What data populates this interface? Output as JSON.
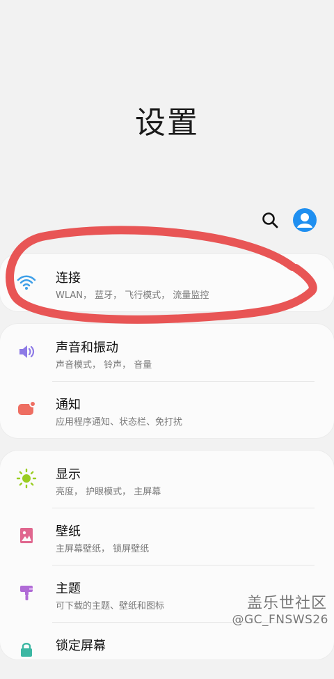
{
  "page": {
    "title": "设置"
  },
  "header": {
    "search_icon": "search-icon",
    "profile_icon": "profile-avatar-icon"
  },
  "colors": {
    "annotation_red": "#e74c4c",
    "wifi_blue": "#3e9fe8",
    "sound_purple": "#8d7ae6",
    "notify_coral": "#ee6e62",
    "display_green": "#9acd22",
    "wallpaper_pink": "#e0668e",
    "theme_violet": "#b06bd6",
    "avatar_blue": "#1f8ff0"
  },
  "sections": [
    {
      "items": [
        {
          "id": "connections",
          "icon": "wifi-icon",
          "title": "连接",
          "subtitle": "WLAN， 蓝牙， 飞行模式， 流量监控"
        }
      ]
    },
    {
      "items": [
        {
          "id": "sounds",
          "icon": "speaker-icon",
          "title": "声音和振动",
          "subtitle": "声音模式， 铃声， 音量"
        },
        {
          "id": "notifications",
          "icon": "notification-icon",
          "title": "通知",
          "subtitle": "应用程序通知、状态栏、免打扰"
        }
      ]
    },
    {
      "items": [
        {
          "id": "display",
          "icon": "brightness-icon",
          "title": "显示",
          "subtitle": "亮度， 护眼模式， 主屏幕"
        },
        {
          "id": "wallpaper",
          "icon": "wallpaper-icon",
          "title": "壁纸",
          "subtitle": "主屏幕壁纸， 锁屏壁纸"
        },
        {
          "id": "themes",
          "icon": "theme-brush-icon",
          "title": "主题",
          "subtitle": "可下载的主题、壁纸和图标"
        },
        {
          "id": "lockscreen",
          "icon": "lock-icon",
          "title": "锁定屏幕",
          "subtitle": ""
        }
      ]
    }
  ],
  "watermark": {
    "site": "盖乐世社区",
    "handle": "@GC_FNSWS26"
  }
}
